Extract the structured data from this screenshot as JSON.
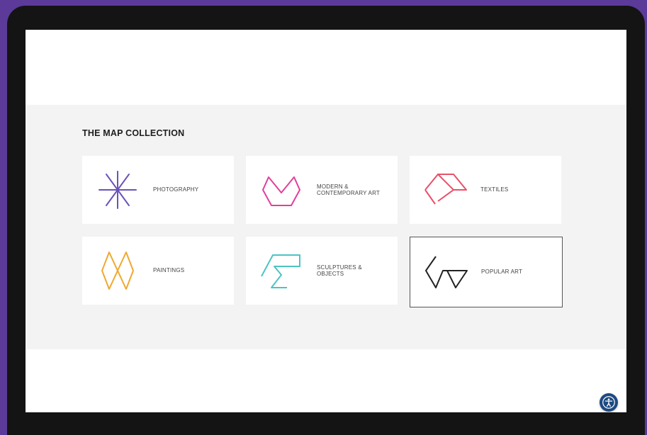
{
  "collection": {
    "title": "THE MAP COLLECTION",
    "items": [
      {
        "label": "PHOTOGRAPHY",
        "icon": "asterisk-star-icon",
        "color": "#6a52b8"
      },
      {
        "label": "MODERN & CONTEMPORARY ART",
        "icon": "letter-m-icon",
        "color": "#e0409a"
      },
      {
        "label": "TEXTILES",
        "icon": "folded-diamond-icon",
        "color": "#e8506a"
      },
      {
        "label": "PAINTINGS",
        "icon": "hexagon-x-icon",
        "color": "#f0a830"
      },
      {
        "label": "SCULPTURES & OBJECTS",
        "icon": "pedestal-icon",
        "color": "#4cc4c4"
      },
      {
        "label": "POPULAR ART",
        "icon": "angle-triangle-icon",
        "color": "#222222"
      }
    ],
    "selected_label": "POPULAR ART"
  },
  "accessibility": {
    "icon": "accessibility-icon",
    "color": "#1d4a80"
  }
}
